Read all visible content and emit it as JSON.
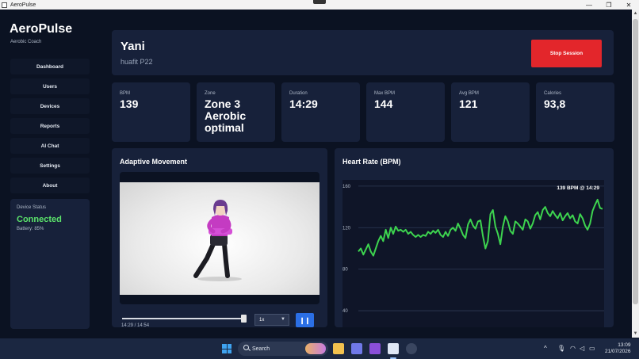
{
  "window": {
    "title": "AeroPulse",
    "controls": [
      "—",
      "❐",
      "✕"
    ]
  },
  "sidebar": {
    "brand": "AeroPulse",
    "subtitle": "Aerobic Coach",
    "items": [
      {
        "label": "Dashboard"
      },
      {
        "label": "Users"
      },
      {
        "label": "Devices"
      },
      {
        "label": "Reports"
      },
      {
        "label": "AI Chat"
      },
      {
        "label": "Settings"
      },
      {
        "label": "About"
      }
    ],
    "device": {
      "label": "Device Status",
      "status": "Connected",
      "battery": "Battery: 85%"
    }
  },
  "header": {
    "user_name": "Yani",
    "device_name": "huafit P22",
    "stop_label": "Stop Session"
  },
  "stats": [
    {
      "label": "BPM",
      "value": "139"
    },
    {
      "label": "Zone",
      "value": "Zone 3 Aerobic optimal"
    },
    {
      "label": "Duration",
      "value": "14:29"
    },
    {
      "label": "Max BPM",
      "value": "144"
    },
    {
      "label": "Avg BPM",
      "value": "121"
    },
    {
      "label": "Calories",
      "value": "93,8"
    }
  ],
  "movement": {
    "title": "Adaptive Movement",
    "time": "14:29 / 14:54",
    "progress": 0.974,
    "speed": "1x",
    "pause_label": "❙❙"
  },
  "heart_panel": {
    "title": "Heart Rate (BPM)"
  },
  "chart_data": {
    "type": "line",
    "title": "Heart Rate (BPM)",
    "ylim": [
      24,
      166
    ],
    "yticks": [
      160,
      120,
      80,
      40
    ],
    "grid": true,
    "annotation": "139 BPM @ 14:29",
    "line_color": "#3dd44f",
    "series": [
      {
        "values": [
          97,
          100,
          94,
          99,
          104,
          97,
          93,
          100,
          107,
          112,
          107,
          118,
          110,
          120,
          114,
          121,
          117,
          118,
          116,
          118,
          114,
          116,
          113,
          111,
          113,
          111,
          113,
          112,
          116,
          114,
          117,
          115,
          118,
          113,
          111,
          116,
          112,
          118,
          120,
          117,
          124,
          119,
          113,
          110,
          123,
          128,
          122,
          119,
          126,
          127,
          112,
          100,
          107,
          133,
          137,
          121,
          114,
          104,
          121,
          131,
          126,
          117,
          114,
          126,
          124,
          121,
          118,
          128,
          126,
          119,
          124,
          132,
          135,
          128,
          137,
          140,
          134,
          131,
          136,
          132,
          129,
          134,
          127,
          131,
          134,
          129,
          132,
          126,
          124,
          133,
          129,
          122,
          118,
          124,
          136,
          142,
          147,
          139,
          138
        ]
      }
    ]
  },
  "taskbar": {
    "search_label": "Search",
    "tray_up": "^",
    "clock_time": "13:09",
    "clock_date": "21/07/2026"
  },
  "colors": {
    "accent": "#2b6fe5",
    "danger": "#e3262b",
    "success": "#5be36b",
    "panel": "#17213a",
    "background": "#0b1222"
  }
}
